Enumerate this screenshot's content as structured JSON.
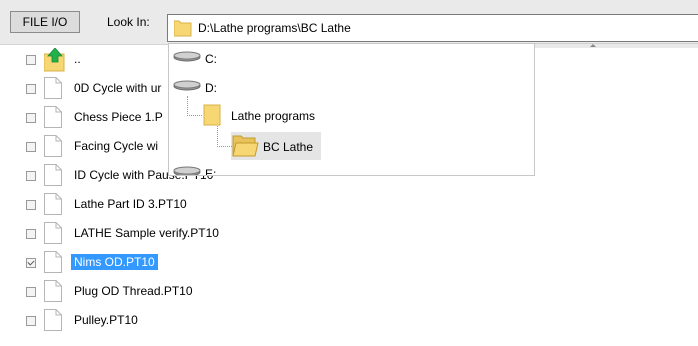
{
  "toolbar": {
    "file_io_label": "FILE I/O",
    "look_in_label": "Look In:",
    "current_path": "D:\\Lathe programs\\BC Lathe"
  },
  "files": [
    {
      "name": "..",
      "kind": "parent-folder",
      "checked": false
    },
    {
      "name": "0D Cycle with ur",
      "kind": "file",
      "checked": false
    },
    {
      "name": "Chess Piece 1.P",
      "kind": "file",
      "checked": false
    },
    {
      "name": "Facing Cycle wi",
      "kind": "file",
      "checked": false
    },
    {
      "name": "ID Cycle with Pause.PT10",
      "kind": "file",
      "checked": false
    },
    {
      "name": "Lathe Part ID 3.PT10",
      "kind": "file",
      "checked": false
    },
    {
      "name": "LATHE Sample verify.PT10",
      "kind": "file",
      "checked": false
    },
    {
      "name": "Nims OD.PT10",
      "kind": "file",
      "checked": true,
      "selected": true
    },
    {
      "name": "Plug OD Thread.PT10",
      "kind": "file",
      "checked": false
    },
    {
      "name": "Pulley.PT10",
      "kind": "file",
      "checked": false
    }
  ],
  "dropdown": {
    "items": [
      {
        "label": "C:",
        "kind": "drive"
      },
      {
        "label": "D:",
        "kind": "drive"
      },
      {
        "label": "Lathe programs",
        "kind": "folder"
      },
      {
        "label": "BC Lathe",
        "kind": "open-folder",
        "selected": true
      },
      {
        "label": "E:",
        "kind": "drive"
      }
    ]
  },
  "colors": {
    "selection": "#3399ff",
    "toolbar_bg": "#eaeaea",
    "folder": "#f7d774"
  }
}
